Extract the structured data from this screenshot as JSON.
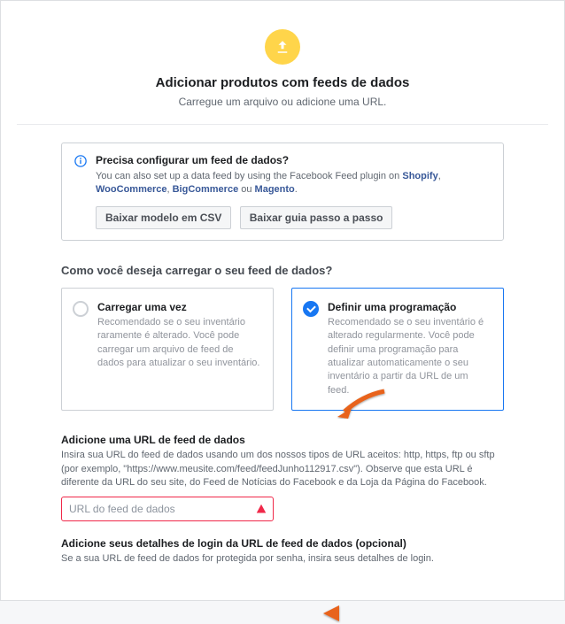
{
  "header": {
    "title": "Adicionar produtos com feeds de dados",
    "subtitle": "Carregue um arquivo ou adicione uma URL."
  },
  "info": {
    "title": "Precisa configurar um feed de dados?",
    "text_prefix": "You can also set up a data feed by using the Facebook Feed plugin on ",
    "link_shopify": "Shopify",
    "link_woo": "WooCommerce",
    "link_big": "BigCommerce",
    "sep1": ", ",
    "sep2": ", ",
    "sep_or": " ou ",
    "link_magento": "Magento",
    "period": ".",
    "btn_csv": "Baixar modelo em CSV",
    "btn_guide": "Baixar guia passo a passo"
  },
  "upload_question": "Como você deseja carregar o seu feed de dados?",
  "options": {
    "once": {
      "title": "Carregar uma vez",
      "desc": "Recomendado se o seu inventário raramente é alterado. Você pode carregar um arquivo de feed de dados para atualizar o seu inventário."
    },
    "schedule": {
      "title": "Definir uma programação",
      "desc": "Recomendado se o seu inventário é alterado regularmente. Você pode definir uma programação para atualizar automaticamente o seu inventário a partir da URL de um feed."
    }
  },
  "url_field": {
    "label": "Adicione uma URL de feed de dados",
    "desc": "Insira sua URL do feed de dados usando um dos nossos tipos de URL aceitos: http, https, ftp ou sftp (por exemplo, \"https://www.meusite.com/feed/feedJunho112917.csv\"). Observe que esta URL é diferente da URL do seu site, do Feed de Notícias do Facebook e da Loja da Página do Facebook.",
    "placeholder": "URL do feed de dados"
  },
  "login_field": {
    "label": "Adicione seus detalhes de login da URL de feed de dados (opcional)",
    "desc": "Se a sua URL de feed de dados for protegida por senha, insira seus detalhes de login."
  }
}
